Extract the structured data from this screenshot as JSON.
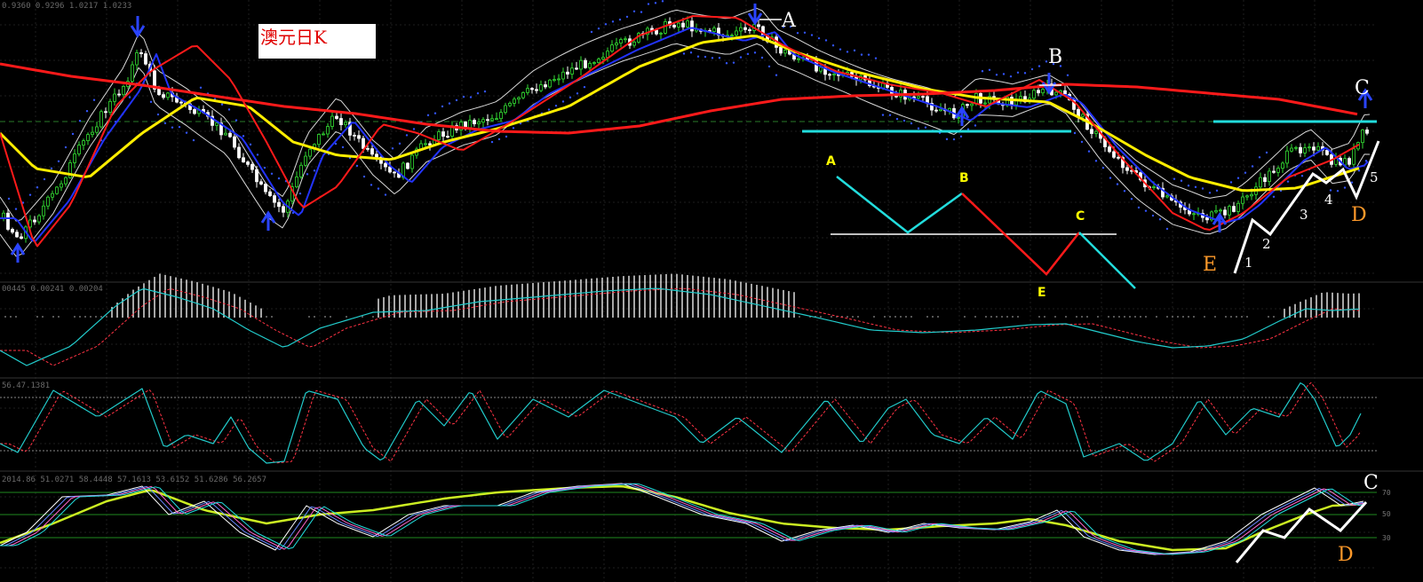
{
  "title": "澳元日K",
  "chart_data": {
    "type": "candlestick",
    "instrument": "澳元",
    "timeframe": "日K",
    "panels": [
      {
        "name": "price",
        "header": "0.9360 0.9296 1.0217 1.0233"
      },
      {
        "name": "macd",
        "header": "00445 0.00241 0.00204"
      },
      {
        "name": "stochastic",
        "header": "56.47.1381",
        "levels": [
          80,
          20
        ]
      },
      {
        "name": "rsi",
        "header": "2014.86 51.0271 58.4448 57.1613 53.6152 51.6286 56.2657",
        "axis_labels": [
          "70",
          "50",
          "30"
        ]
      }
    ],
    "wave_labels": {
      "A": "A",
      "B": "B",
      "C": "C",
      "D": "D",
      "E": "E",
      "impulse": [
        "1",
        "2",
        "3",
        "4",
        "5"
      ]
    },
    "schematic": {
      "labels": [
        "A",
        "B",
        "C",
        "E"
      ]
    },
    "colors": {
      "bull_candle": "#33dd33",
      "bear_candle": "#ffffff",
      "ma_red": "#ff1a1a",
      "ma_yellow": "#ffee00",
      "ma_blue": "#2233ff",
      "band_white": "#d8d8d8",
      "dots": "#3355ff",
      "arrow": "#2a44ff",
      "neckline": "#22dddd",
      "grid": "#1e1e1e",
      "macd_signal": "#ff3344",
      "macd_main": "#22cccc"
    }
  }
}
